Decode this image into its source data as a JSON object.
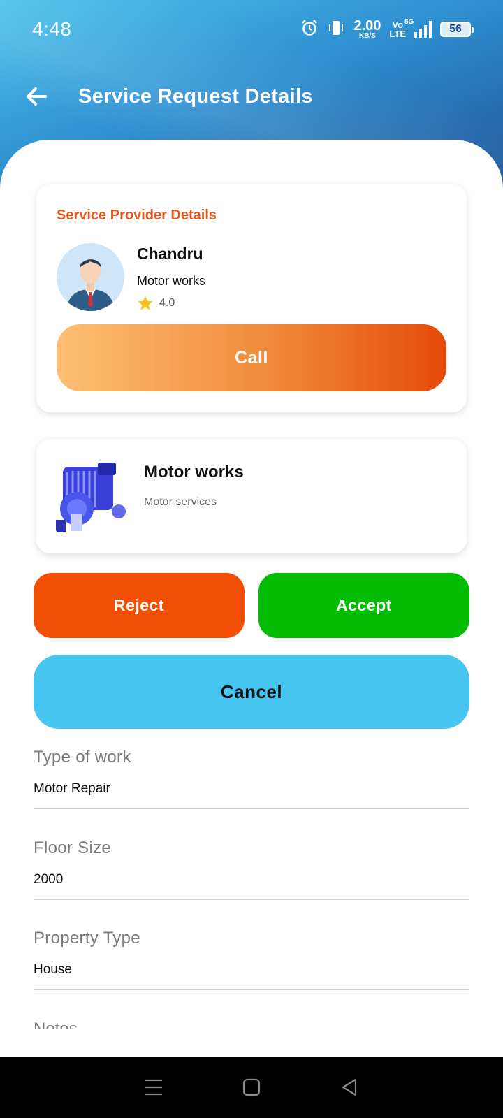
{
  "status_bar": {
    "time": "4:48",
    "net_speed_value": "2.00",
    "net_speed_unit": "KB/S",
    "volte_top": "Vo",
    "volte_bottom": "LTE",
    "network_label": "5G",
    "battery": "56",
    "icons": [
      "alarm-icon",
      "vibrate-icon",
      "signal-icon",
      "battery-icon"
    ]
  },
  "app_bar": {
    "title": "Service Request Details",
    "back_icon": "arrow-left-icon"
  },
  "provider": {
    "heading": "Service Provider Details",
    "name": "Chandru",
    "service": "Motor works",
    "rating": "4.0",
    "call_label": "Call"
  },
  "service": {
    "title": "Motor works",
    "subtitle": "Motor services"
  },
  "actions": {
    "reject_label": "Reject",
    "accept_label": "Accept",
    "cancel_label": "Cancel"
  },
  "details": {
    "type_of_work_label": "Type of work",
    "type_of_work_value": "Motor Repair",
    "floor_size_label": "Floor Size",
    "floor_size_value": "2000",
    "property_type_label": "Property Type",
    "property_type_value": "House",
    "notes_label": "Notes"
  },
  "colors": {
    "accent_orange": "#e8551b",
    "reject": "#f24f06",
    "accept": "#03bc03",
    "cancel": "#45c5f0",
    "header_start": "#4cc3ee",
    "header_end": "#1c4f94"
  }
}
